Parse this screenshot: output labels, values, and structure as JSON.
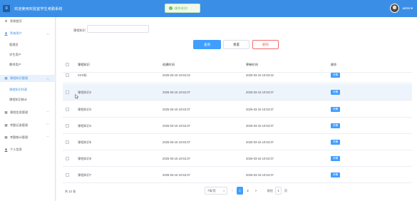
{
  "header": {
    "menu_icon": "menu-icon",
    "title": "欢迎使用实验室学生考勤系统",
    "user_name": "admin▾",
    "avatar_icon": "user-avatar"
  },
  "toast": {
    "icon": "success-check-icon",
    "text": "操作成功!"
  },
  "sidebar": {
    "items": [
      {
        "label": "系统首页",
        "icon": "gear-icon",
        "expandable": false
      },
      {
        "label": "系统用户",
        "icon": "user-icon",
        "expandable": true
      },
      {
        "label": "管理员",
        "sub": true
      },
      {
        "label": "学生用户",
        "sub": true
      },
      {
        "label": "教师用户",
        "sub": true
      },
      {
        "label": "课程知识管理",
        "icon": "grid-icon",
        "expandable": true,
        "active": true
      },
      {
        "label": "课程知识列表",
        "sub": true,
        "active": true
      },
      {
        "label": "课程知识统计",
        "sub": true
      },
      {
        "label": "课程信息管理",
        "icon": "grid-icon",
        "expandable": true
      },
      {
        "label": "考勤记录管理",
        "icon": "grid-icon",
        "expandable": true
      },
      {
        "label": "考勤统计管理",
        "icon": "grid-icon",
        "expandable": true
      },
      {
        "label": "个人信息",
        "icon": "user-icon",
        "expandable": false
      }
    ]
  },
  "search": {
    "label": "课程知识",
    "value": "",
    "placeholder": ""
  },
  "buttons": {
    "query": "查询",
    "reset": "重置",
    "delete": "删除"
  },
  "table": {
    "headers": [
      "课程知识",
      "创建时间",
      "更新时间",
      "操作"
    ],
    "rows": [
      {
        "name": "XXX知",
        "created": "2025-03-15 10:53:22",
        "updated": "2025-03-15 10:53:22",
        "action": "详情"
      },
      {
        "name": "课程知识2",
        "created": "2025-03-15 10:53:37",
        "updated": "2025-03-15 10:53:37",
        "action": "详情"
      },
      {
        "name": "课程知识3",
        "created": "2025-03-15 10:53:37",
        "updated": "2025-03-15 10:53:37",
        "action": "详情"
      },
      {
        "name": "课程知识4",
        "created": "2025-03-15 10:53:37",
        "updated": "2025-03-15 10:53:37",
        "action": "详情"
      },
      {
        "name": "课程知识5",
        "created": "2025-03-15 10:53:37",
        "updated": "2025-03-15 10:53:37",
        "action": "详情"
      },
      {
        "name": "课程知识6",
        "created": "2025-03-15 10:53:37",
        "updated": "2025-03-15 10:53:37",
        "action": "详情"
      },
      {
        "name": "课程知识7",
        "created": "2025-03-15 10:53:37",
        "updated": "2025-03-15 10:53:37",
        "action": "详情"
      }
    ]
  },
  "pagination": {
    "total": "共 12 条",
    "page_size": "7条/页",
    "prev": "<",
    "pages": [
      "1",
      "2"
    ],
    "current_page": "1",
    "next": ">",
    "goto_prefix": "前往",
    "goto_value": "1",
    "goto_suffix": "页"
  },
  "colors": {
    "header_bg": "#3a8ee6",
    "primary": "#409eff",
    "danger": "#f56c6c",
    "success": "#67c23a"
  }
}
